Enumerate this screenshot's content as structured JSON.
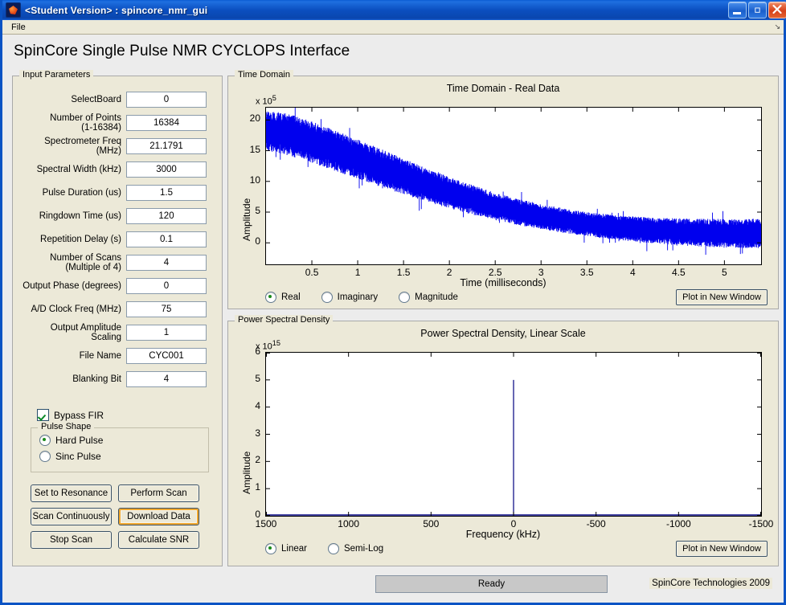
{
  "window": {
    "title": "<Student Version> : spincore_nmr_gui",
    "icon": "matlab-icon",
    "minimize_label": "Minimize",
    "maximize_label": "Maximize",
    "close_label": "Close"
  },
  "menu": {
    "items": [
      "File"
    ]
  },
  "header": {
    "title": "SpinCore Single Pulse NMR CYCLOPS Interface"
  },
  "input_panel": {
    "title": "Input Parameters",
    "fields": [
      {
        "label": "SelectBoard",
        "label2": "",
        "value": "0"
      },
      {
        "label": "Number of Points",
        "label2": "(1-16384)",
        "value": "16384"
      },
      {
        "label": "Spectrometer Freq (MHz)",
        "label2": "",
        "value": "21.1791"
      },
      {
        "label": "Spectral Width (kHz)",
        "label2": "",
        "value": "3000"
      },
      {
        "label": "Pulse Duration (us)",
        "label2": "",
        "value": "1.5"
      },
      {
        "label": "Ringdown Time (us)",
        "label2": "",
        "value": "120"
      },
      {
        "label": "Repetition Delay (s)",
        "label2": "",
        "value": "0.1"
      },
      {
        "label": "Number of Scans",
        "label2": "(Multiple of 4)",
        "value": "4"
      },
      {
        "label": "Output Phase (degrees)",
        "label2": "",
        "value": "0"
      },
      {
        "label": "A/D Clock Freq (MHz)",
        "label2": "",
        "value": "75"
      },
      {
        "label": "Output Amplitude Scaling",
        "label2": "",
        "value": "1"
      },
      {
        "label": "File Name",
        "label2": "",
        "value": "CYC001"
      },
      {
        "label": "Blanking Bit",
        "label2": "",
        "value": "4"
      }
    ],
    "bypass_fir": {
      "label": "Bypass FIR",
      "checked": true
    },
    "pulse_shape": {
      "title": "Pulse Shape",
      "options": [
        {
          "label": "Hard Pulse",
          "selected": true
        },
        {
          "label": "Sinc Pulse",
          "selected": false
        }
      ]
    },
    "buttons": [
      {
        "label": "Set to Resonance",
        "focused": false
      },
      {
        "label": "Perform Scan",
        "focused": false
      },
      {
        "label": "Scan Continuously",
        "focused": false
      },
      {
        "label": "Download Data",
        "focused": true
      },
      {
        "label": "Stop Scan",
        "focused": false
      },
      {
        "label": "Calculate SNR",
        "focused": false
      }
    ]
  },
  "time_domain": {
    "panel_title": "Time Domain",
    "display_modes": [
      {
        "label": "Real",
        "selected": true
      },
      {
        "label": "Imaginary",
        "selected": false
      },
      {
        "label": "Magnitude",
        "selected": false
      }
    ],
    "plot_button": "Plot in New Window"
  },
  "psd": {
    "panel_title": "Power Spectral Density",
    "scale_modes": [
      {
        "label": "Linear",
        "selected": true
      },
      {
        "label": "Semi-Log",
        "selected": false
      }
    ],
    "plot_button": "Plot in New Window"
  },
  "status": {
    "text": "Ready"
  },
  "footer": {
    "copyright": "SpinCore Technologies 2009"
  },
  "colors": {
    "panel_bg": "#ece9d8",
    "window_bg": "#ececec",
    "trace_time": "#0000ee",
    "trace_psd": "#000080",
    "focus_ring": "#f0a830",
    "title_bar": "#0a4fc0"
  },
  "chart_data": [
    {
      "type": "line",
      "id": "time-domain-chart",
      "title": "Time Domain - Real Data",
      "xlabel": "Time (milliseconds)",
      "ylabel": "Amplitude",
      "y_exponent_text": "x 10",
      "y_exponent": "5",
      "xlim": [
        0,
        5.4
      ],
      "ylim": [
        -3.5,
        22
      ],
      "xticks": [
        0.5,
        1,
        1.5,
        2,
        2.5,
        3,
        3.5,
        4,
        4.5,
        5
      ],
      "xticklabels": [
        "0.5",
        "1",
        "1.5",
        "2",
        "2.5",
        "3",
        "3.5",
        "4",
        "4.5",
        "5"
      ],
      "yticks": [
        0,
        5,
        10,
        15,
        20
      ],
      "yticklabels": [
        "0",
        "5",
        "10",
        "15",
        "20"
      ],
      "grid": false,
      "legend": "none",
      "series": [
        {
          "name": "Real FID",
          "description": "Noisy exponentially decaying free induction decay oscillating about a decaying baseline",
          "envelope_upper": [
            [
              0.0,
              21.5
            ],
            [
              0.25,
              21.0
            ],
            [
              0.5,
              19.8
            ],
            [
              0.75,
              18.4
            ],
            [
              1.0,
              16.9
            ],
            [
              1.25,
              15.3
            ],
            [
              1.5,
              13.7
            ],
            [
              1.75,
              12.2
            ],
            [
              2.0,
              10.7
            ],
            [
              2.25,
              9.4
            ],
            [
              2.5,
              8.2
            ],
            [
              2.75,
              7.2
            ],
            [
              3.0,
              6.3
            ],
            [
              3.25,
              5.6
            ],
            [
              3.5,
              5.0
            ],
            [
              3.75,
              4.6
            ],
            [
              4.0,
              4.3
            ],
            [
              4.25,
              4.1
            ],
            [
              4.5,
              4.0
            ],
            [
              4.75,
              3.9
            ],
            [
              5.0,
              3.9
            ],
            [
              5.4,
              3.9
            ]
          ],
          "envelope_lower": [
            [
              0.0,
              15.0
            ],
            [
              0.25,
              14.2
            ],
            [
              0.5,
              13.0
            ],
            [
              0.75,
              11.7
            ],
            [
              1.0,
              10.4
            ],
            [
              1.25,
              9.1
            ],
            [
              1.5,
              7.9
            ],
            [
              1.75,
              6.7
            ],
            [
              2.0,
              5.6
            ],
            [
              2.25,
              4.6
            ],
            [
              2.5,
              3.7
            ],
            [
              2.75,
              2.9
            ],
            [
              3.0,
              2.2
            ],
            [
              3.25,
              1.6
            ],
            [
              3.5,
              1.1
            ],
            [
              3.75,
              0.6
            ],
            [
              4.0,
              0.2
            ],
            [
              4.25,
              -0.1
            ],
            [
              4.5,
              -0.4
            ],
            [
              4.75,
              -0.6
            ],
            [
              5.0,
              -0.8
            ],
            [
              5.4,
              -0.9
            ]
          ],
          "noise_amplitude": 1.1
        }
      ]
    },
    {
      "type": "line",
      "id": "psd-chart",
      "title": "Power Spectral Density, Linear Scale",
      "xlabel": "Frequency (kHz)",
      "ylabel": "Amplitude",
      "y_exponent_text": "x 10",
      "y_exponent": "15",
      "xlim": [
        1500,
        -1500
      ],
      "ylim": [
        0,
        6
      ],
      "x_axis_reversed": true,
      "xticks": [
        1500,
        1000,
        500,
        0,
        -500,
        -1000,
        -1500
      ],
      "xticklabels": [
        "1500",
        "1000",
        "500",
        "0",
        "-500",
        "-1000",
        "-1500"
      ],
      "yticks": [
        0,
        1,
        2,
        3,
        4,
        5,
        6
      ],
      "yticklabels": [
        "0",
        "1",
        "2",
        "3",
        "4",
        "5",
        "6"
      ],
      "grid": false,
      "legend": "none",
      "series": [
        {
          "name": "Power Spectral Density",
          "description": "Flat baseline near zero across the full band with a single narrow peak at 0 kHz",
          "peak_frequency_khz": 0,
          "peak_value": 5.0,
          "baseline_value": 0.03
        }
      ]
    }
  ]
}
